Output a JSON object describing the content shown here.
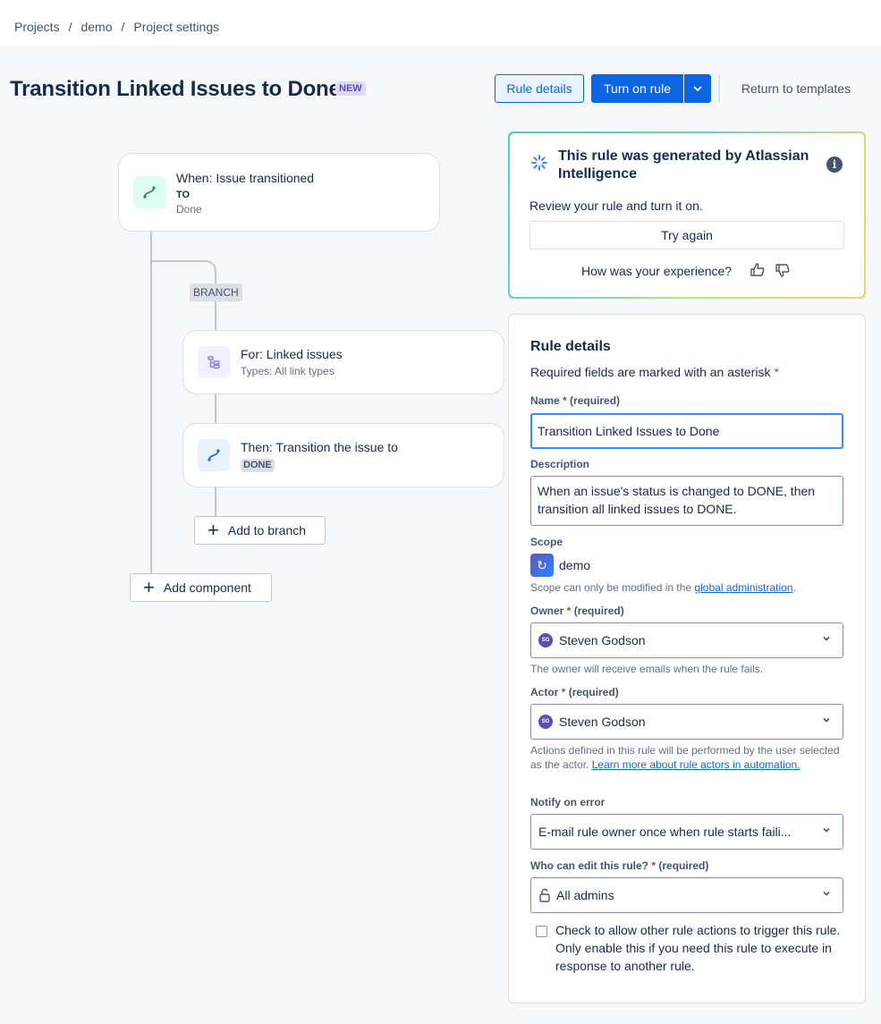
{
  "breadcrumb": {
    "items": [
      "Projects",
      "demo",
      "Project settings"
    ],
    "separator": "/"
  },
  "header": {
    "title": "Transition Linked Issues to Done",
    "badge": "NEW",
    "rule_details_button": "Rule details",
    "turn_on_button": "Turn on rule",
    "return_button": "Return to templates"
  },
  "flow": {
    "trigger": {
      "title": "When: Issue transitioned",
      "qualifier": "TO",
      "value": "Done",
      "icon": "transition-icon"
    },
    "branch_label": "BRANCH",
    "branch": {
      "title": "For: Linked issues",
      "subtitle": "Types: All link types",
      "icon": "branch-tree-icon"
    },
    "action": {
      "title": "Then: Transition the issue to",
      "status": "DONE",
      "icon": "transition-icon"
    },
    "add_to_branch": "Add to branch",
    "add_component": "Add component"
  },
  "ai_panel": {
    "title": "This rule was generated by Atlassian Intelligence",
    "review_text": "Review your rule and turn it on.",
    "try_again": "Try again",
    "experience_question": "How was your experience?"
  },
  "details": {
    "heading": "Rule details",
    "required_note": "Required fields are marked with an asterisk",
    "name_label": "Name",
    "required_text": "(required)",
    "name_value": "Transition Linked Issues to Done",
    "description_label": "Description",
    "description_value": "When an issue's status is changed to DONE, then transition all linked issues to DONE.",
    "scope_label": "Scope",
    "scope_value": "demo",
    "scope_help_prefix": "Scope can only be modified in the ",
    "scope_help_link": "global administration",
    "scope_help_suffix": ".",
    "owner_label": "Owner",
    "owner_initials": "SG",
    "owner_value": "Steven Godson",
    "owner_help": "The owner will receive emails when the rule fails.",
    "actor_label": "Actor",
    "actor_initials": "SG",
    "actor_value": "Steven Godson",
    "actor_help_prefix": "Actions defined in this rule will be performed by the user selected as the actor. ",
    "actor_help_link": "Learn more about rule actors in automation.",
    "notify_label": "Notify on error",
    "notify_value": "E-mail rule owner once when rule starts faili...",
    "edit_label": "Who can edit this rule?",
    "edit_value": "All admins",
    "checkbox_label": "Check to allow other rule actions to trigger this rule. Only enable this if you need this rule to execute in response to another rule."
  },
  "colors": {
    "primary": "#0c66e4",
    "danger": "#c9372c",
    "badge_bg": "#dfd8fd"
  }
}
